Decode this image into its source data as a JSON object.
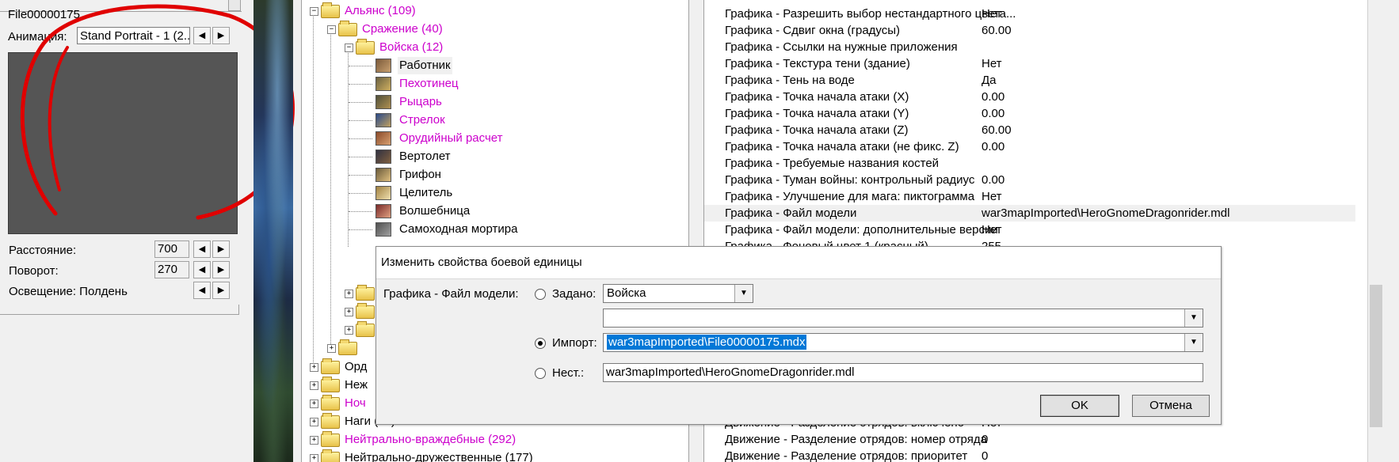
{
  "left": {
    "file_name": "File00000175",
    "animation_label": "Анимация:",
    "animation_value": "Stand Portrait - 1 (2...",
    "spin_left": "◀",
    "spin_right": "▶",
    "distance_label": "Расстояние:",
    "distance_value": "700",
    "rotation_label": "Поворот:",
    "rotation_value": "270",
    "lighting_label": "Освещение: Полдень"
  },
  "tree": {
    "nodes": [
      {
        "label": "Альянс (109)",
        "magenta": true
      },
      {
        "label": "Сражение (40)",
        "magenta": true
      },
      {
        "label": "Войска (12)",
        "magenta": true
      },
      {
        "label": "Работник",
        "magenta": false
      },
      {
        "label": "Пехотинец",
        "magenta": true
      },
      {
        "label": "Рыцарь",
        "magenta": true
      },
      {
        "label": "Стрелок",
        "magenta": true
      },
      {
        "label": "Орудийный расчет",
        "magenta": true
      },
      {
        "label": "Вертолет",
        "magenta": false
      },
      {
        "label": "Грифон",
        "magenta": false
      },
      {
        "label": "Целитель",
        "magenta": false
      },
      {
        "label": "Волшебница",
        "magenta": false
      },
      {
        "label": "Самоходная мортира",
        "magenta": false
      }
    ],
    "lower_nodes": [
      {
        "label": "Орд",
        "magenta": false
      },
      {
        "label": "Неж",
        "magenta": false
      },
      {
        "label": "Ноч",
        "magenta": true
      },
      {
        "label": "Наги (19)",
        "magenta": false
      },
      {
        "label": "Нейтрально-враждебные (292)",
        "magenta": true
      },
      {
        "label": "Нейтрально-дружественные (177)",
        "magenta": false
      }
    ]
  },
  "props": {
    "rows": [
      {
        "name": "Графика - Разрешить выбор нестандартного цвета...",
        "value": "Нет"
      },
      {
        "name": "Графика - Сдвиг окна (градусы)",
        "value": "60.00"
      },
      {
        "name": "Графика - Ссылки на нужные приложения",
        "value": ""
      },
      {
        "name": "Графика - Текстура тени (здание)",
        "value": "Нет"
      },
      {
        "name": "Графика - Тень на воде",
        "value": "Да"
      },
      {
        "name": "Графика - Точка начала атаки (X)",
        "value": "0.00"
      },
      {
        "name": "Графика - Точка начала атаки (Y)",
        "value": "0.00"
      },
      {
        "name": "Графика - Точка начала атаки (Z)",
        "value": "60.00"
      },
      {
        "name": "Графика - Точка начала атаки (не фикс. Z)",
        "value": "0.00"
      },
      {
        "name": "Графика - Требуемые названия костей",
        "value": ""
      },
      {
        "name": "Графика - Туман войны: контрольный радиус",
        "value": "0.00"
      },
      {
        "name": "Графика - Улучшение для мага: пиктограмма",
        "value": "Нет"
      },
      {
        "name": "Графика - Файл модели",
        "value": "war3mapImported\\HeroGnomeDragonrider.mdl"
      },
      {
        "name": "Графика - Файл модели: дополнительные версии",
        "value": "Нет"
      },
      {
        "name": "Графика - Фоновый цвет 1 (красный)",
        "value": "255"
      }
    ],
    "bottom_rows": [
      {
        "name": "Движение - Разделение отрядов: включено",
        "value": "Нет"
      },
      {
        "name": "Движение - Разделение отрядов: номер отряда",
        "value": "0"
      },
      {
        "name": "Движение - Разделение отрядов: приоритет",
        "value": "0"
      }
    ]
  },
  "dialog": {
    "title": "Изменить свойства боевой единицы",
    "field_label": "Графика - Файл модели:",
    "preset_label": "Задано:",
    "preset_value": "Войска",
    "preset_sub_value": "",
    "import_label": "Импорт:",
    "import_value": "war3mapImported\\File00000175.mdx",
    "custom_label": "Нест.:",
    "custom_value": "war3mapImported\\HeroGnomeDragonrider.mdl",
    "ok_label": "OK",
    "cancel_label": "Отмена",
    "dropdown_arrow": "▼"
  }
}
